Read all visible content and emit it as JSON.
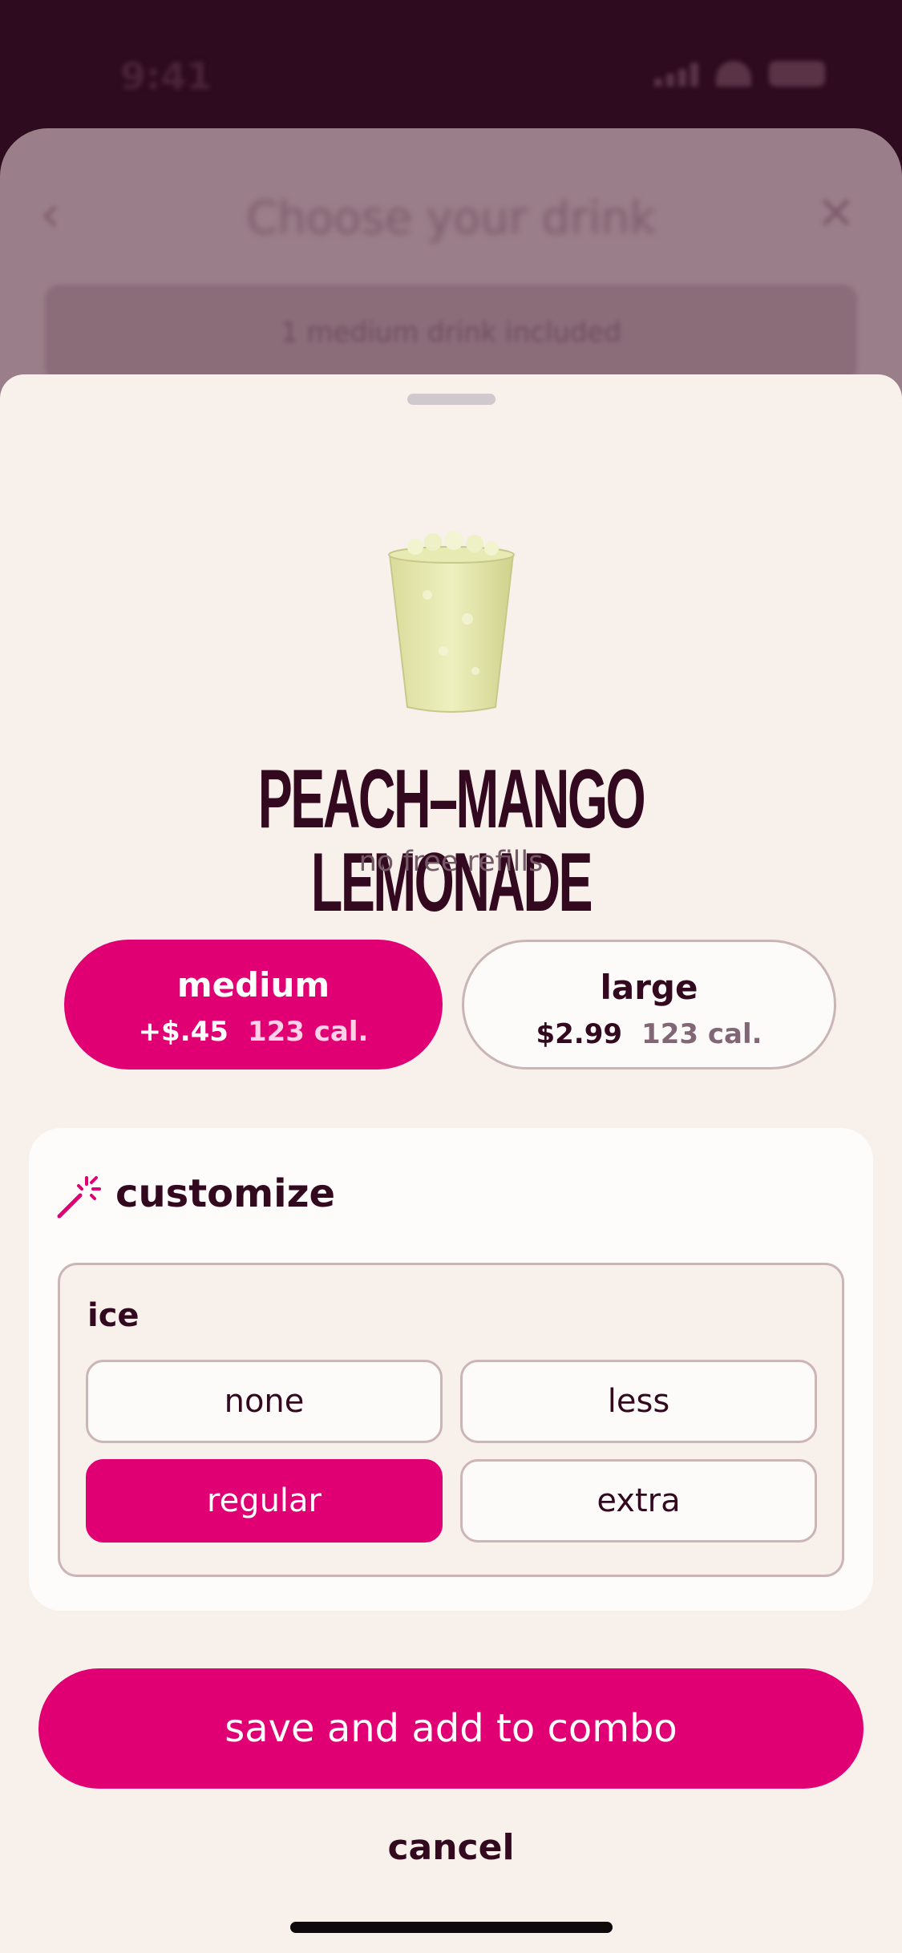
{
  "status_bar": {
    "time": "9:41"
  },
  "background": {
    "title": "Choose your drink",
    "banner": "1 medium drink included"
  },
  "drink": {
    "name": "PEACH–MANGO LEMONADE",
    "note": "no free refills"
  },
  "sizes": [
    {
      "label": "medium",
      "price": "+$.45",
      "calories": "123 cal.",
      "selected": true
    },
    {
      "label": "large",
      "price": "$2.99",
      "calories": "123 cal.",
      "selected": false
    }
  ],
  "customize": {
    "title": "customize",
    "ice": {
      "label": "ice",
      "options": [
        "none",
        "less",
        "regular",
        "extra"
      ],
      "selected": "regular"
    }
  },
  "actions": {
    "save_label": "save and add to combo",
    "cancel_label": "cancel"
  },
  "colors": {
    "brand": "#e00074",
    "text": "#33091f",
    "sheet": "#f7f0eb",
    "backdrop": "#2e0b1e"
  },
  "icons": [
    "back-chevron-icon",
    "close-icon",
    "magic-wand-icon",
    "cellular-signal-icon",
    "wifi-icon",
    "battery-icon"
  ]
}
